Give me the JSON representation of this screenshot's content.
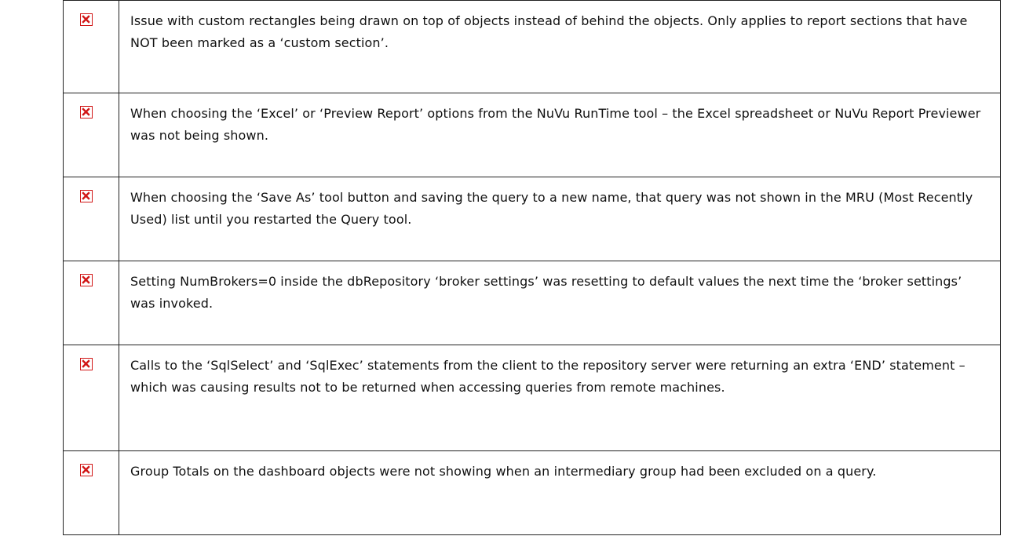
{
  "icon": {
    "name": "red-x-checkbox-icon",
    "border_color": "#d11717",
    "mark_color": "#d11717"
  },
  "issues": [
    {
      "text": "Issue with custom rectangles being drawn on top of objects instead of behind the objects.  Only applies to report sections that have NOT been marked as a ‘custom section’."
    },
    {
      "text": "When choosing the ‘Excel’ or ‘Preview Report’ options from the NuVu RunTime tool – the Excel spreadsheet or NuVu Report Previewer was not being shown."
    },
    {
      "text": "When choosing the ‘Save As’ tool button and saving the query to a new name, that query was not shown in the MRU (Most Recently Used) list until you restarted the Query tool."
    },
    {
      "text": "Setting NumBrokers=0 inside the dbRepository ‘broker settings’ was resetting to default values the next time the ‘broker settings’ was invoked."
    },
    {
      "text": "Calls to the ‘SqlSelect’ and ‘SqlExec’ statements from the client to the repository server were returning an extra ‘END’ statement – which was causing results not to be returned when accessing queries from remote machines."
    },
    {
      "text": "Group Totals on the dashboard objects were not showing when an intermediary group had been excluded on a query."
    }
  ]
}
